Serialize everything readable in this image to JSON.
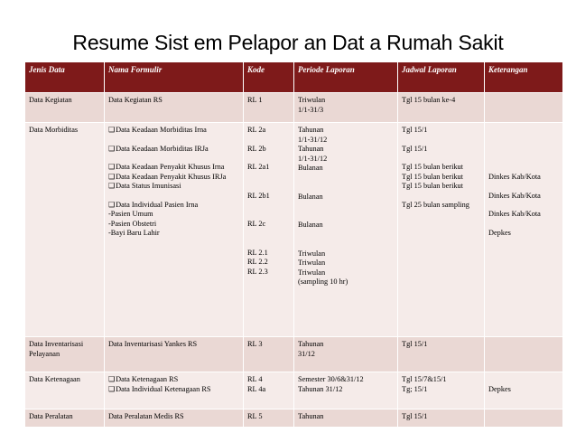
{
  "title": "Resume Sist em Pelapor an Dat a Rumah Sakit",
  "headers": [
    "Jenis Data",
    "Nama Formulir",
    "Kode",
    "Periode Laporan",
    "Jadwal Laporan",
    "Keterangan"
  ],
  "rows": [
    {
      "jenis": "Data Kegiatan",
      "formulir": [
        "Data Kegiatan RS"
      ],
      "kode": "RL 1",
      "periode": [
        "Triwulan",
        "1/1-31/3"
      ],
      "jadwal": "Tgl 15 bulan ke-4",
      "ket": ""
    },
    {
      "jenis": "Data Morbiditas",
      "formulir": {
        "irna": "Data Keadaan Morbiditas Irna",
        "irja": "Data Keadaan Morbiditas IRJa",
        "khusus_irna": "Data Keadaan Penyakit Khusus Irna",
        "khusus_irja": "Data Keadaan Penyakit Khusus IRJa",
        "imunisasi": "Data Status Imunisasi",
        "individual": "Data Individual Pasien Irna",
        "umum": "-Pasien Umum",
        "obstetri": "-Pasien Obstetri",
        "bayi": "-Bayi Baru Lahir"
      },
      "kode": [
        "RL 2a",
        "RL 2b",
        "RL 2a1",
        "RL 2b1",
        "RL 2c",
        "RL 2.1",
        "RL 2.2",
        "RL 2.3"
      ],
      "periode": {
        "p1": [
          "Tahunan",
          "1/1-31/12"
        ],
        "p2": [
          "Tahunan",
          "1/1-31/12"
        ],
        "p3": "Bulanan",
        "p4": "Bulanan",
        "p5": "Bulanan",
        "p6": [
          "Triwulan",
          "Triwulan",
          "Triwulan",
          "(sampling 10 hr)"
        ]
      },
      "jadwal": {
        "j1": "Tgl 15/1",
        "j2": "Tgl 15/1",
        "j3": "Tgl 15 bulan berikut",
        "j4": "Tgl 15 bulan berikut",
        "j5": "Tgl 15 bulan berikut",
        "j6": "Tgl 25 bulan sampling"
      },
      "ket": [
        "Dinkes Kab/Kota",
        "Dinkes Kab/Kota",
        "Dinkes Kab/Kota",
        "Depkes"
      ]
    },
    {
      "jenis": "Data Inventarisasi Pelayanan",
      "formulir": [
        "Data Inventarisasi Yankes RS"
      ],
      "kode": "RL 3",
      "periode": [
        "Tahunan",
        "31/12"
      ],
      "jadwal": "Tgl 15/1",
      "ket": ""
    },
    {
      "jenis": "Data Ketenagaan",
      "formulir": [
        "Data Ketenagaan RS",
        "Data Individual Ketenagaan RS"
      ],
      "kode": [
        "RL 4",
        "RL 4a"
      ],
      "periode": [
        "Semester 30/6&31/12",
        "Tahunan 31/12"
      ],
      "jadwal": [
        "Tgl 15/7&15/1",
        "Tg; 15/1"
      ],
      "ket": "Depkes"
    },
    {
      "jenis": "Data Peralatan",
      "formulir": [
        "Data Peralatan Medis RS"
      ],
      "kode": "RL 5",
      "periode": [
        "Tahunan"
      ],
      "jadwal": "Tgl 15/1",
      "ket": ""
    }
  ]
}
